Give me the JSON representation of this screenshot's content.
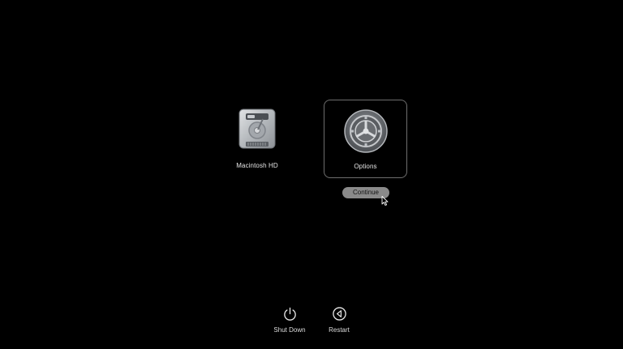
{
  "boot_options": [
    {
      "label": "Macintosh HD",
      "icon": "hard-drive-icon"
    },
    {
      "label": "Options",
      "icon": "gear-icon",
      "selected": true
    }
  ],
  "continue_button": {
    "label": "Continue"
  },
  "power_controls": {
    "shutdown": {
      "label": "Shut Down",
      "icon": "power-icon"
    },
    "restart": {
      "label": "Restart",
      "icon": "restart-icon"
    }
  },
  "colors": {
    "background": "#000000",
    "selection_border": "#6e6e6e",
    "button_fill": "#8a8a8a"
  }
}
